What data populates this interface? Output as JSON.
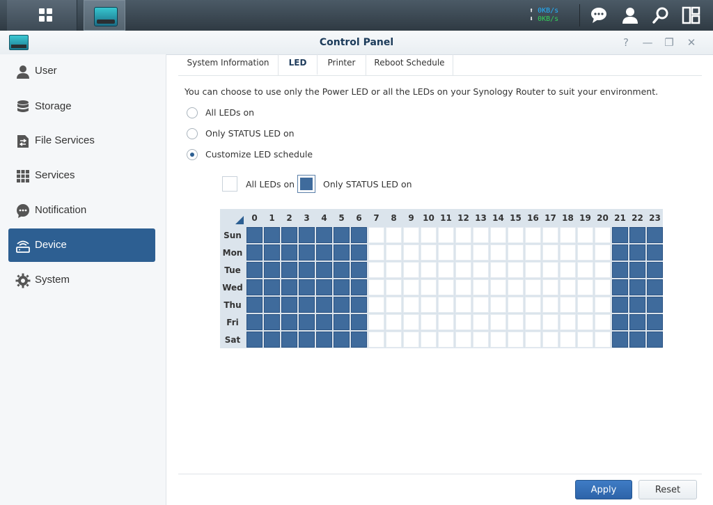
{
  "taskbar": {
    "upload_speed": "0KB/s",
    "download_speed": "0KB/s",
    "arrow_up": "⬆",
    "arrow_down": "⬇",
    "icons": [
      "main-menu-icon",
      "control-panel-app-icon",
      "chat-icon",
      "user-icon",
      "search-icon",
      "widgets-icon"
    ]
  },
  "window": {
    "title": "Control Panel",
    "controls": {
      "help": "?",
      "minimize": "—",
      "restore": "❐",
      "close": "✕"
    }
  },
  "sidebar": {
    "items": [
      {
        "label": "User",
        "icon": "user-icon"
      },
      {
        "label": "Storage",
        "icon": "storage-icon"
      },
      {
        "label": "File Services",
        "icon": "file-services-icon"
      },
      {
        "label": "Services",
        "icon": "services-icon"
      },
      {
        "label": "Notification",
        "icon": "notification-icon"
      },
      {
        "label": "Device",
        "icon": "device-icon",
        "active": true
      },
      {
        "label": "System",
        "icon": "system-icon"
      }
    ]
  },
  "tabs": [
    {
      "label": "System Information"
    },
    {
      "label": "LED",
      "active": true
    },
    {
      "label": "Printer"
    },
    {
      "label": "Reboot Schedule"
    }
  ],
  "led": {
    "description": "You can choose to use only the Power LED or all the LEDs on your Synology Router to suit your environment.",
    "options": [
      {
        "label": "All LEDs on",
        "selected": false
      },
      {
        "label": "Only STATUS LED on",
        "selected": false
      },
      {
        "label": "Customize LED schedule",
        "selected": true
      }
    ],
    "legend": {
      "all_on": "All LEDs on",
      "status_only": "Only STATUS LED on"
    }
  },
  "schedule": {
    "hours": [
      "0",
      "1",
      "2",
      "3",
      "4",
      "5",
      "6",
      "7",
      "8",
      "9",
      "10",
      "11",
      "12",
      "13",
      "14",
      "15",
      "16",
      "17",
      "18",
      "19",
      "20",
      "21",
      "22",
      "23"
    ],
    "days": [
      "Sun",
      "Mon",
      "Tue",
      "Wed",
      "Thu",
      "Fri",
      "Sat"
    ],
    "status_only_hours": [
      0,
      1,
      2,
      3,
      4,
      5,
      6,
      21,
      22,
      23
    ],
    "colors": {
      "status_only": "#3f6b9c",
      "all_on": "#ffffff"
    }
  },
  "buttons": {
    "apply": "Apply",
    "reset": "Reset"
  },
  "colors": {
    "accent": "#2d5f92",
    "taskbar": "#3a4650"
  }
}
